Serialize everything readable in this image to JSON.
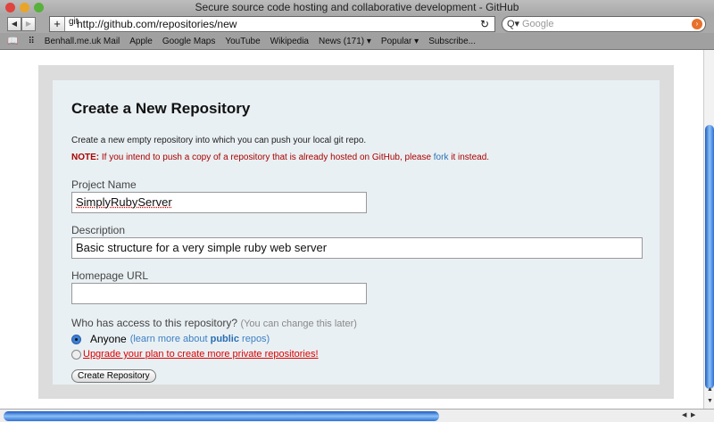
{
  "window": {
    "title": "Secure source code hosting and collaborative development - GitHub"
  },
  "toolbar": {
    "back": "◀",
    "forward": "▶",
    "add": "+",
    "url": "http://github.com/repositories/new",
    "favicon": "git",
    "reload": "↻",
    "search_placeholder": "Google",
    "search_icon": "Q▾",
    "search_go": "›"
  },
  "bookmarks": {
    "items": [
      "Benhall.me.uk Mail",
      "Apple",
      "Google Maps",
      "YouTube",
      "Wikipedia",
      "News (171) ▾",
      "Popular ▾",
      "Subscribe..."
    ],
    "book_icon": "📖",
    "grid_icon": "⠿"
  },
  "page": {
    "heading": "Create a New Repository",
    "intro": "Create a new empty repository into which you can push your local git repo.",
    "note_label": "NOTE:",
    "note_text": " If you intend to push a copy of a repository that is already hosted on GitHub, please ",
    "note_link": "fork",
    "note_end": " it instead.",
    "project_label": "Project Name",
    "project_value": "SimplyRubyServer",
    "description_label": "Description",
    "description_value": "Basic structure for a very simple ruby web server",
    "homepage_label": "Homepage URL",
    "homepage_value": "",
    "access_question": "Who has access to this repository?",
    "access_hint": "(You can change this later)",
    "anyone_label": "Anyone",
    "learn_pre": "(learn more about ",
    "learn_bold": "public",
    "learn_post": " repos)",
    "upgrade_link": "Upgrade your plan to create more private repositories!",
    "submit": "Create Repository"
  },
  "colors": {
    "accent": "#2a6fb4",
    "note": "#aa0000",
    "panel": "#e9f0f3"
  }
}
